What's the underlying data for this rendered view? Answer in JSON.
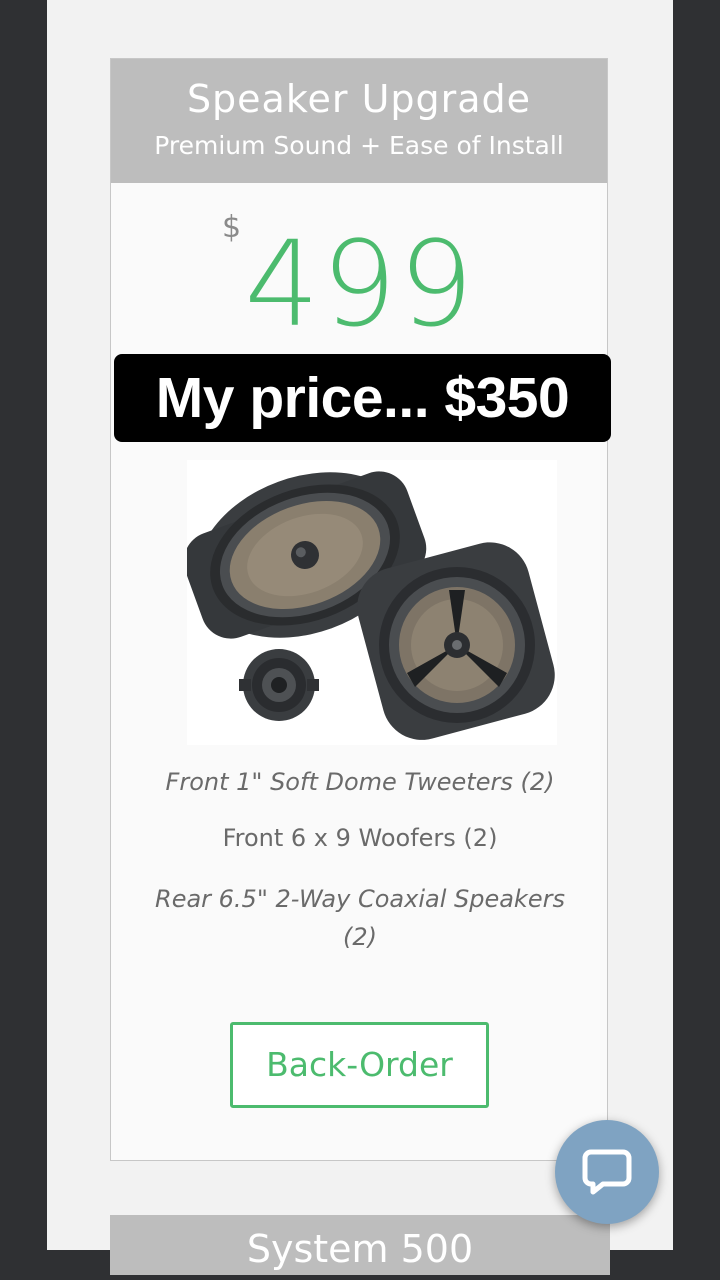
{
  "card": {
    "title": "Speaker Upgrade",
    "subtitle": "Premium Sound + Ease of Install",
    "currency": "$",
    "price": "499",
    "promo": "My price... $350",
    "features": [
      "Front 1\" Soft Dome Tweeters (2)",
      "Front 6 x 9 Woofers (2)",
      "Rear 6.5\" 2-Way Coaxial Speakers (2)"
    ],
    "cta_label": "Back-Order"
  },
  "next_card": {
    "title": "System 500"
  },
  "chat": {
    "icon": "chat-bubble-icon"
  },
  "colors": {
    "accent": "#4cbb6e",
    "header_bg": "#bdbdbd",
    "chat_bg": "#7fa3c2",
    "frame_bg": "#2f3033"
  }
}
